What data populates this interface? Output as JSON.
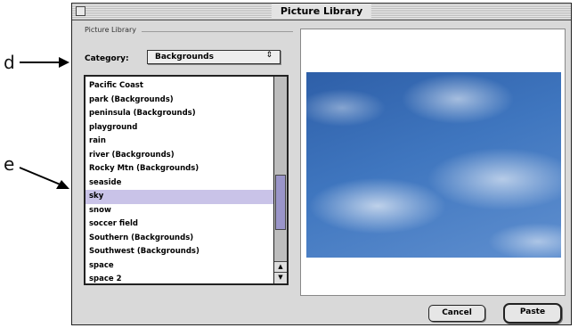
{
  "annotations": {
    "d": "d",
    "e": "e"
  },
  "dialog": {
    "title": "Picture Library",
    "group_label": "Picture Library",
    "category_label": "Category:",
    "category_value": "Backgrounds",
    "list_items": [
      "Pacific Coast",
      "park (Backgrounds)",
      "peninsula (Backgrounds)",
      "playground",
      "rain",
      "river (Backgrounds)",
      "Rocky Mtn (Backgrounds)",
      "seaside",
      "sky",
      "snow",
      "soccer field",
      "Southern (Backgrounds)",
      "Southwest (Backgrounds)",
      "space",
      "space 2"
    ],
    "selected_item": "sky",
    "cancel_label": "Cancel",
    "paste_label": "Paste"
  }
}
